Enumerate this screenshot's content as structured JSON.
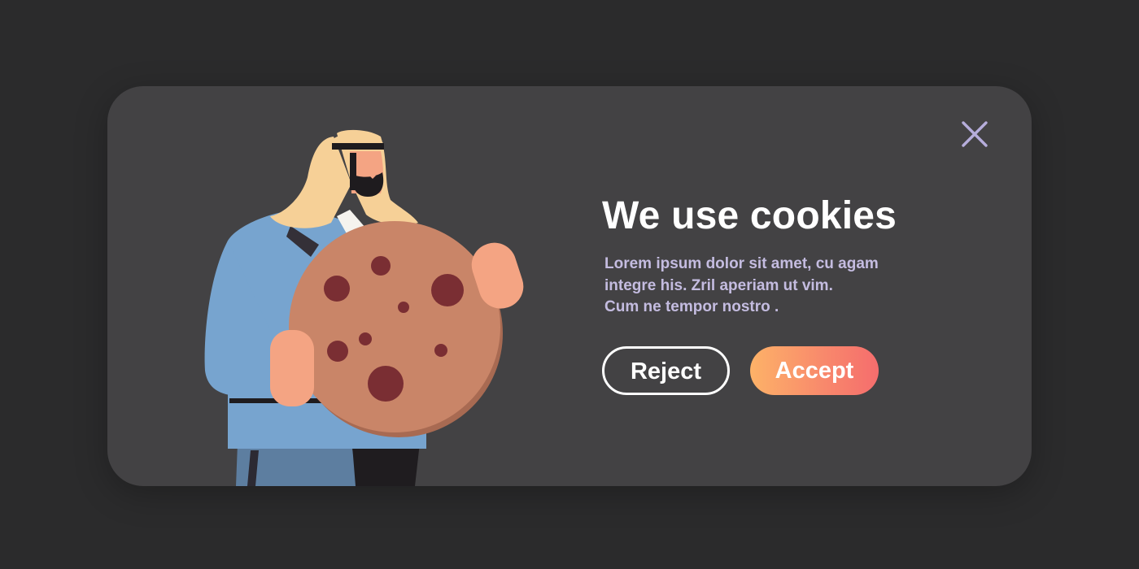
{
  "dialog": {
    "title": "We use cookies",
    "body_lines": [
      "Lorem ipsum dolor sit amet, cu agam",
      "integre his. Zril aperiam ut vim.",
      "Cum ne tempor nostro ."
    ],
    "reject_label": "Reject",
    "accept_label": "Accept",
    "close_icon": "close-icon",
    "illustration_icon": "man-holding-cookie-illustration"
  },
  "colors": {
    "page_background": "#2b2b2c",
    "card_background": "#434244",
    "title": "#ffffff",
    "body_text": "#c4bce0",
    "close_icon": "#b6addb",
    "accept_gradient_start": "#fdb268",
    "accept_gradient_end": "#f56d6d",
    "reject_border": "#ffffff",
    "cookie": "#c98568",
    "cookie_chips": "#7a2e33"
  }
}
